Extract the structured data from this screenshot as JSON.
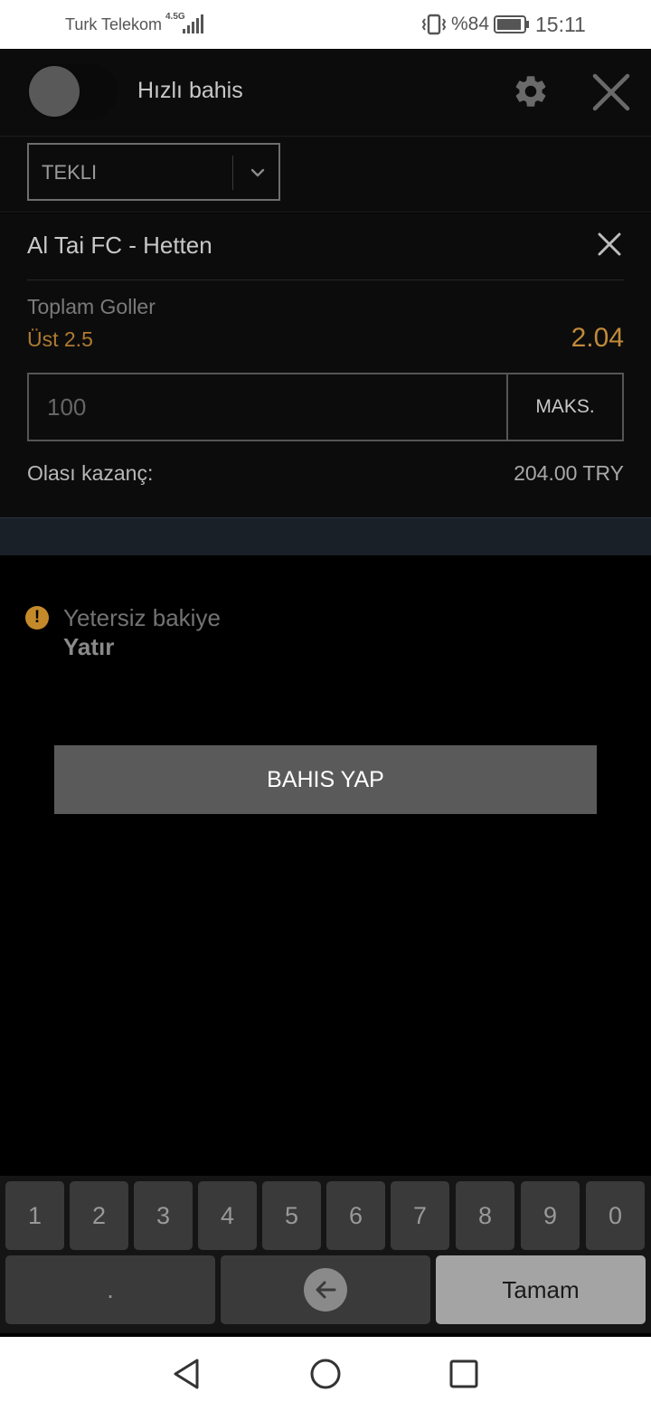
{
  "status_bar": {
    "carrier": "Turk Telekom",
    "network": "4.5G",
    "battery": "%84",
    "time": "15:11"
  },
  "header": {
    "title": "Hızlı bahis",
    "toggle_on": false
  },
  "bet_type": {
    "selected": "TEKLI"
  },
  "bet": {
    "match": "Al Tai FC - Hetten",
    "market": "Toplam Goller",
    "selection": "Üst 2.5",
    "odds": "2.04",
    "stake_placeholder": "100",
    "max_label": "MAKS.",
    "win_label": "Olası kazanç:",
    "win_value": "204.00 TRY"
  },
  "warning": {
    "text": "Yetersiz bakiye",
    "link": "Yatır"
  },
  "place_bet_label": "BAHIS YAP",
  "keyboard": {
    "digits": [
      "1",
      "2",
      "3",
      "4",
      "5",
      "6",
      "7",
      "8",
      "9",
      "0"
    ],
    "dot": ".",
    "done": "Tamam"
  },
  "colors": {
    "accent": "#c08a3a",
    "background": "#000000",
    "panel": "#0c0c0c"
  }
}
